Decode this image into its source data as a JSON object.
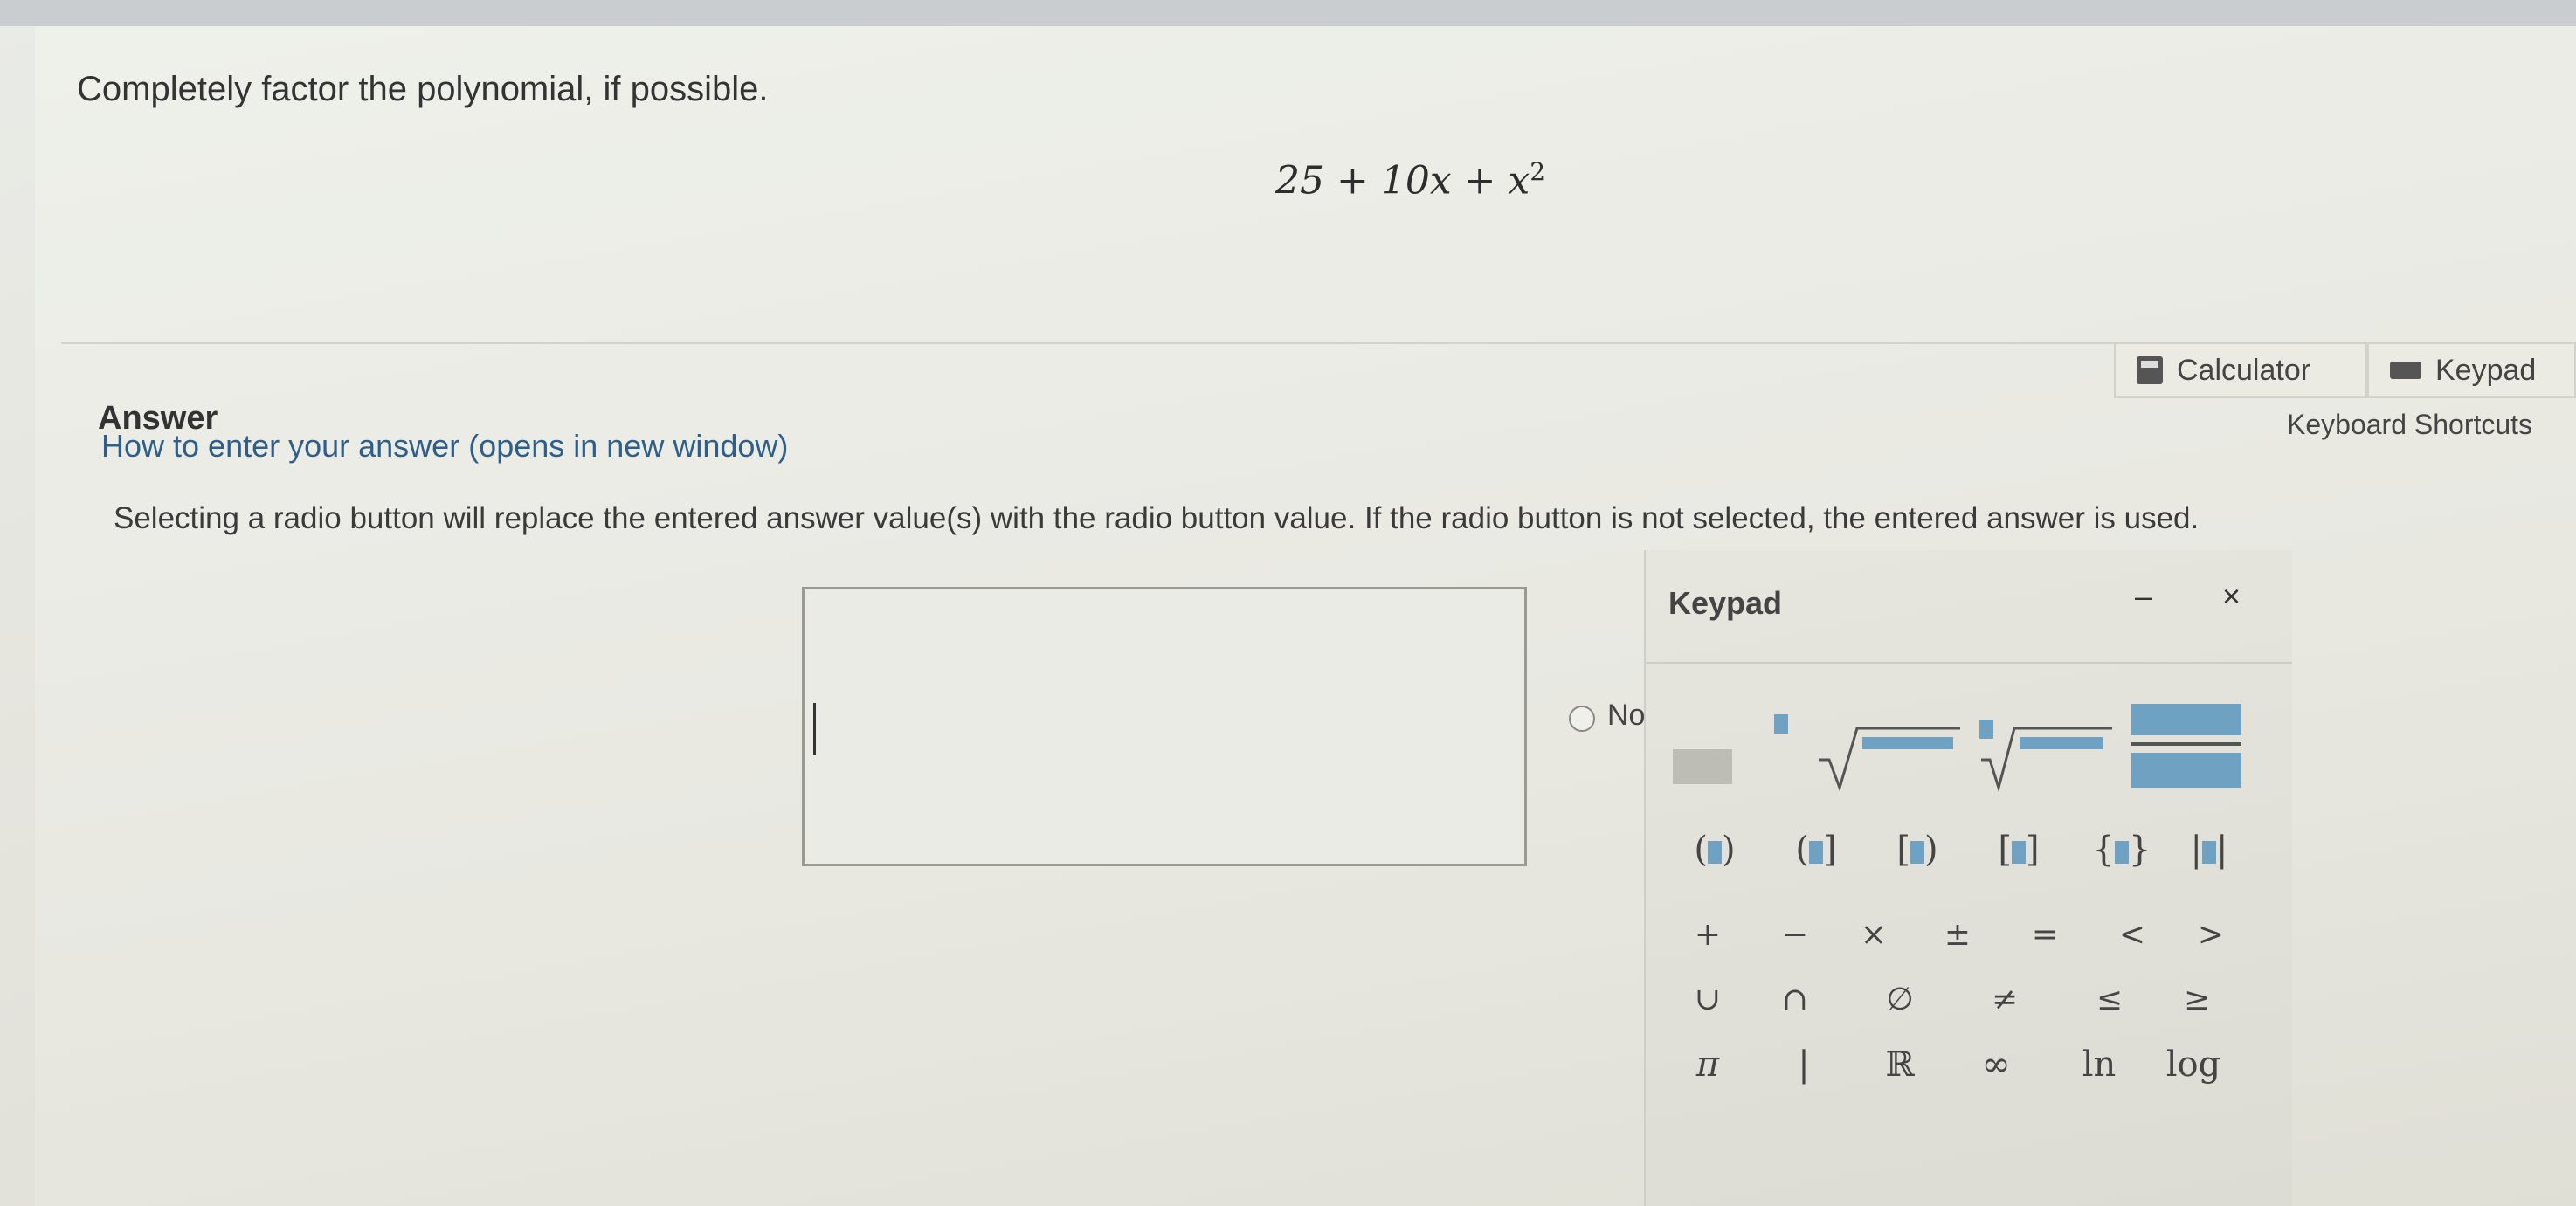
{
  "question": {
    "prompt": "Completely factor the polynomial, if possible.",
    "formula_base": "25 + 10x + x",
    "formula_exp": "2"
  },
  "answer": {
    "title": "Answer",
    "howto_link": "How to enter your answer (opens in new window)",
    "instructions": "Selecting a radio button will replace the entered answer value(s) with the radio button value. If the radio button is not selected, the entered answer is used.",
    "input_value": "",
    "radio_label": "No"
  },
  "tools": {
    "calculator_label": "Calculator",
    "keypad_label": "Keypad",
    "shortcuts_label": "Keyboard Shortcuts"
  },
  "keypad": {
    "title": "Keypad",
    "minimize": "–",
    "close": "×",
    "brackets": [
      "(",
      ")",
      "(",
      "]",
      "[",
      ")",
      "[",
      "]",
      "{",
      "}",
      "|",
      "|"
    ],
    "operators": [
      "+",
      "−",
      "×",
      "±",
      "=",
      "<",
      ">"
    ],
    "sets": [
      "∪",
      "∩",
      "∅",
      "≠",
      "≤",
      "≥"
    ],
    "misc": [
      "π",
      "|",
      "ℝ",
      "∞",
      "ln",
      "log"
    ]
  },
  "colors": {
    "placeholder_box": "#6fa2c2",
    "link": "#2d5f8a"
  }
}
